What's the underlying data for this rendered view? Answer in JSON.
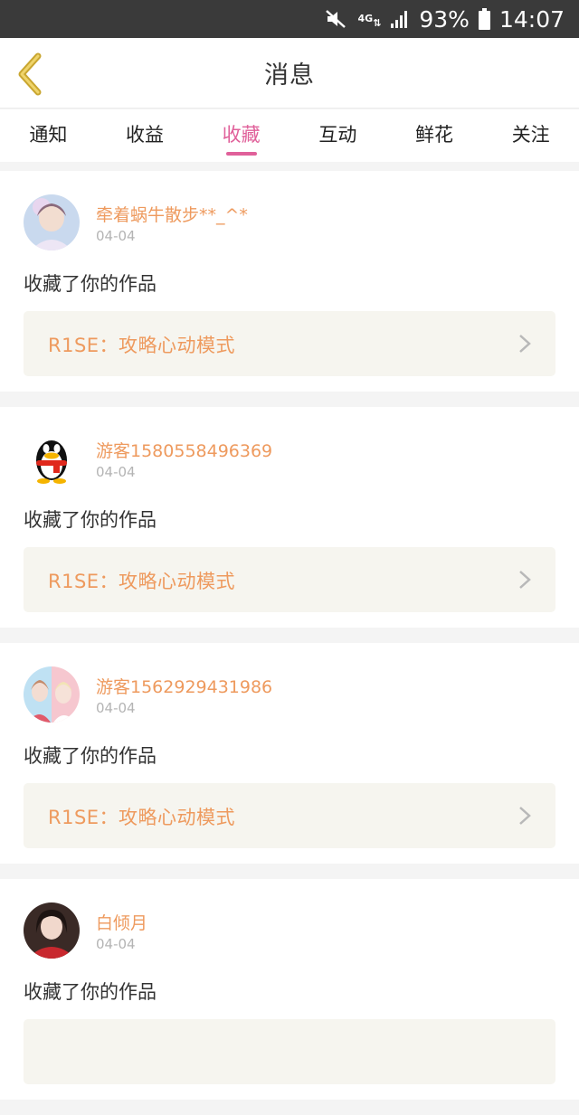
{
  "status_bar": {
    "network": "4G",
    "battery": "93%",
    "time": "14:07"
  },
  "header": {
    "title": "消息"
  },
  "tabs": [
    {
      "label": "通知"
    },
    {
      "label": "收益"
    },
    {
      "label": "收藏",
      "active": true
    },
    {
      "label": "互动"
    },
    {
      "label": "鲜花"
    },
    {
      "label": "关注"
    }
  ],
  "colors": {
    "accent": "#e0609a",
    "username": "#ee9a5e",
    "work_box_bg": "#f6f5ef"
  },
  "items": [
    {
      "username": "牵着蜗牛散步**_^*",
      "date": "04-04",
      "action": "收藏了你的作品",
      "work_title": "R1SE：攻略心动模式",
      "avatar": "avatar-photo-boy"
    },
    {
      "username": "游客1580558496369",
      "date": "04-04",
      "action": "收藏了你的作品",
      "work_title": "R1SE：攻略心动模式",
      "avatar": "penguin-avatar-icon"
    },
    {
      "username": "游客1562929431986",
      "date": "04-04",
      "action": "收藏了你的作品",
      "work_title": "R1SE：攻略心动模式",
      "avatar": "avatar-photo-collage"
    },
    {
      "username": "白倾月",
      "date": "04-04",
      "action": "收藏了你的作品",
      "work_title": "",
      "avatar": "avatar-photo-girl"
    }
  ]
}
